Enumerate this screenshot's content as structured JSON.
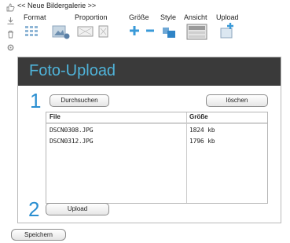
{
  "gallery_nav": {
    "prev": "<<",
    "title": "Neue Bildergalerie",
    "next": ">>"
  },
  "toolbar": {
    "format_label": "Format",
    "proportion_label": "Proportion",
    "size_label": "Größe",
    "style_label": "Style",
    "view_label": "Ansicht",
    "upload_label": "Upload"
  },
  "dialog": {
    "title": "Foto-Upload",
    "step1_number": "1",
    "browse_label": "Durchsuchen",
    "delete_label": "löschen",
    "step2_number": "2",
    "upload_label": "Upload"
  },
  "file_table": {
    "columns": [
      "File",
      "Größe"
    ],
    "rows": [
      {
        "file": "DSCN0308.JPG",
        "size": "1824 kb"
      },
      {
        "file": "DSCN0312.JPG",
        "size": "1796 kb"
      }
    ]
  },
  "footer": {
    "save_label": "Speichern"
  },
  "colors": {
    "accent_blue": "#2b8fd1",
    "title_blue": "#4fb3d9",
    "header_dark": "#3a3a3a"
  }
}
